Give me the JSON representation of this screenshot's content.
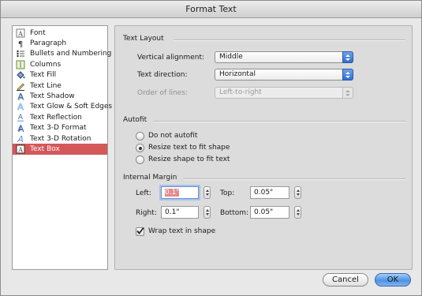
{
  "window": {
    "title": "Format Text"
  },
  "sidebar": {
    "items": [
      {
        "label": "Font",
        "icon": "font-icon",
        "selected": false
      },
      {
        "label": "Paragraph",
        "icon": "paragraph-icon",
        "selected": false
      },
      {
        "label": "Bullets and Numbering",
        "icon": "bullets-icon",
        "selected": false
      },
      {
        "label": "Columns",
        "icon": "columns-icon",
        "selected": false
      },
      {
        "label": "Text Fill",
        "icon": "fill-bucket-icon",
        "selected": false
      },
      {
        "label": "Text Line",
        "icon": "pen-line-icon",
        "selected": false
      },
      {
        "label": "Text Shadow",
        "icon": "shadow-a-icon",
        "selected": false
      },
      {
        "label": "Text Glow & Soft Edges",
        "icon": "glow-a-icon",
        "selected": false
      },
      {
        "label": "Text Reflection",
        "icon": "reflection-a-icon",
        "selected": false
      },
      {
        "label": "Text 3-D Format",
        "icon": "3d-format-a-icon",
        "selected": false
      },
      {
        "label": "Text 3-D Rotation",
        "icon": "3d-rotation-a-icon",
        "selected": false
      },
      {
        "label": "Text Box",
        "icon": "text-box-icon",
        "selected": true
      }
    ]
  },
  "text_layout": {
    "title": "Text Layout",
    "vertical_alignment_label": "Vertical alignment:",
    "vertical_alignment_value": "Middle",
    "text_direction_label": "Text direction:",
    "text_direction_value": "Horizontal",
    "order_of_lines_label": "Order of lines:",
    "order_of_lines_value": "Left-to-right"
  },
  "autofit": {
    "title": "Autofit",
    "options": [
      {
        "label": "Do not autofit",
        "selected": false
      },
      {
        "label": "Resize text to fit shape",
        "selected": true
      },
      {
        "label": "Resize shape to fit text",
        "selected": false
      }
    ]
  },
  "internal_margin": {
    "title": "Internal Margin",
    "left_label": "Left:",
    "left_value": "0.1\"",
    "top_label": "Top:",
    "top_value": "0.05\"",
    "right_label": "Right:",
    "right_value": "0.1\"",
    "bottom_label": "Bottom:",
    "bottom_value": "0.05\"",
    "wrap_label": "Wrap text in shape",
    "wrap_checked": true
  },
  "buttons": {
    "cancel": "Cancel",
    "ok": "OK"
  },
  "colors": {
    "selection": "#d4575a",
    "accent": "#4f93e2"
  }
}
